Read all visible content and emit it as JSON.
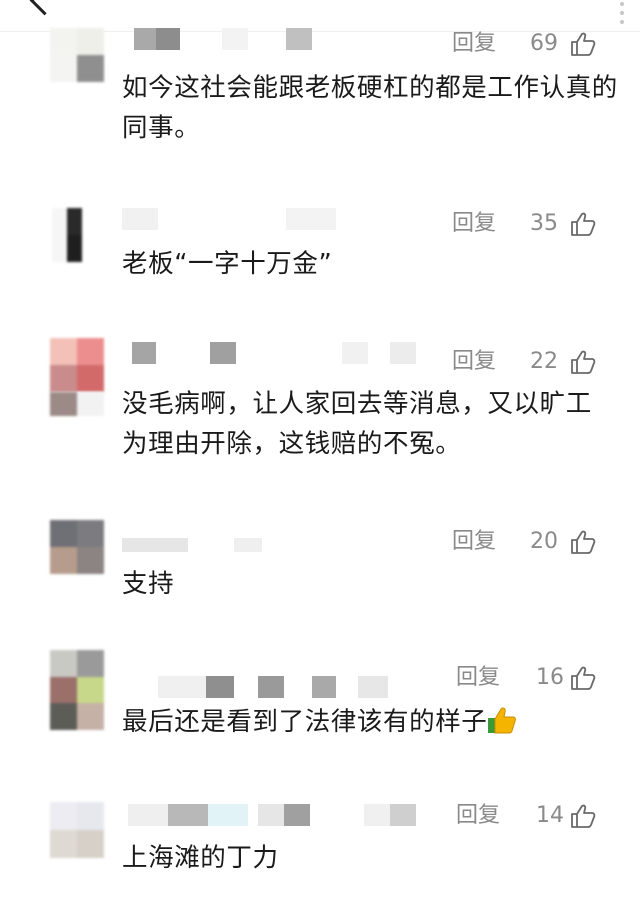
{
  "comments": [
    {
      "reply_label": "回复",
      "likes": "69",
      "text": "如今这社会能跟老板硬杠的都是工作认真的同事。"
    },
    {
      "reply_label": "回复",
      "likes": "35",
      "text": "老板“一字十万金”"
    },
    {
      "reply_label": "回复",
      "likes": "22",
      "text": "没毛病啊，让人家回去等消息，又以旷工为理由开除，这钱赔的不冤。"
    },
    {
      "reply_label": "回复",
      "likes": "20",
      "text": "支持"
    },
    {
      "reply_label": "回复",
      "likes": "16",
      "text": "最后还是看到了法律该有的样子",
      "emoji": "thumbs-up-icon"
    },
    {
      "reply_label": "回复",
      "likes": "14",
      "text": "上海滩的丁力"
    }
  ],
  "colors": {
    "muted": "#8a8a8a",
    "text": "#1a1a1a",
    "background": "#ffffff"
  }
}
